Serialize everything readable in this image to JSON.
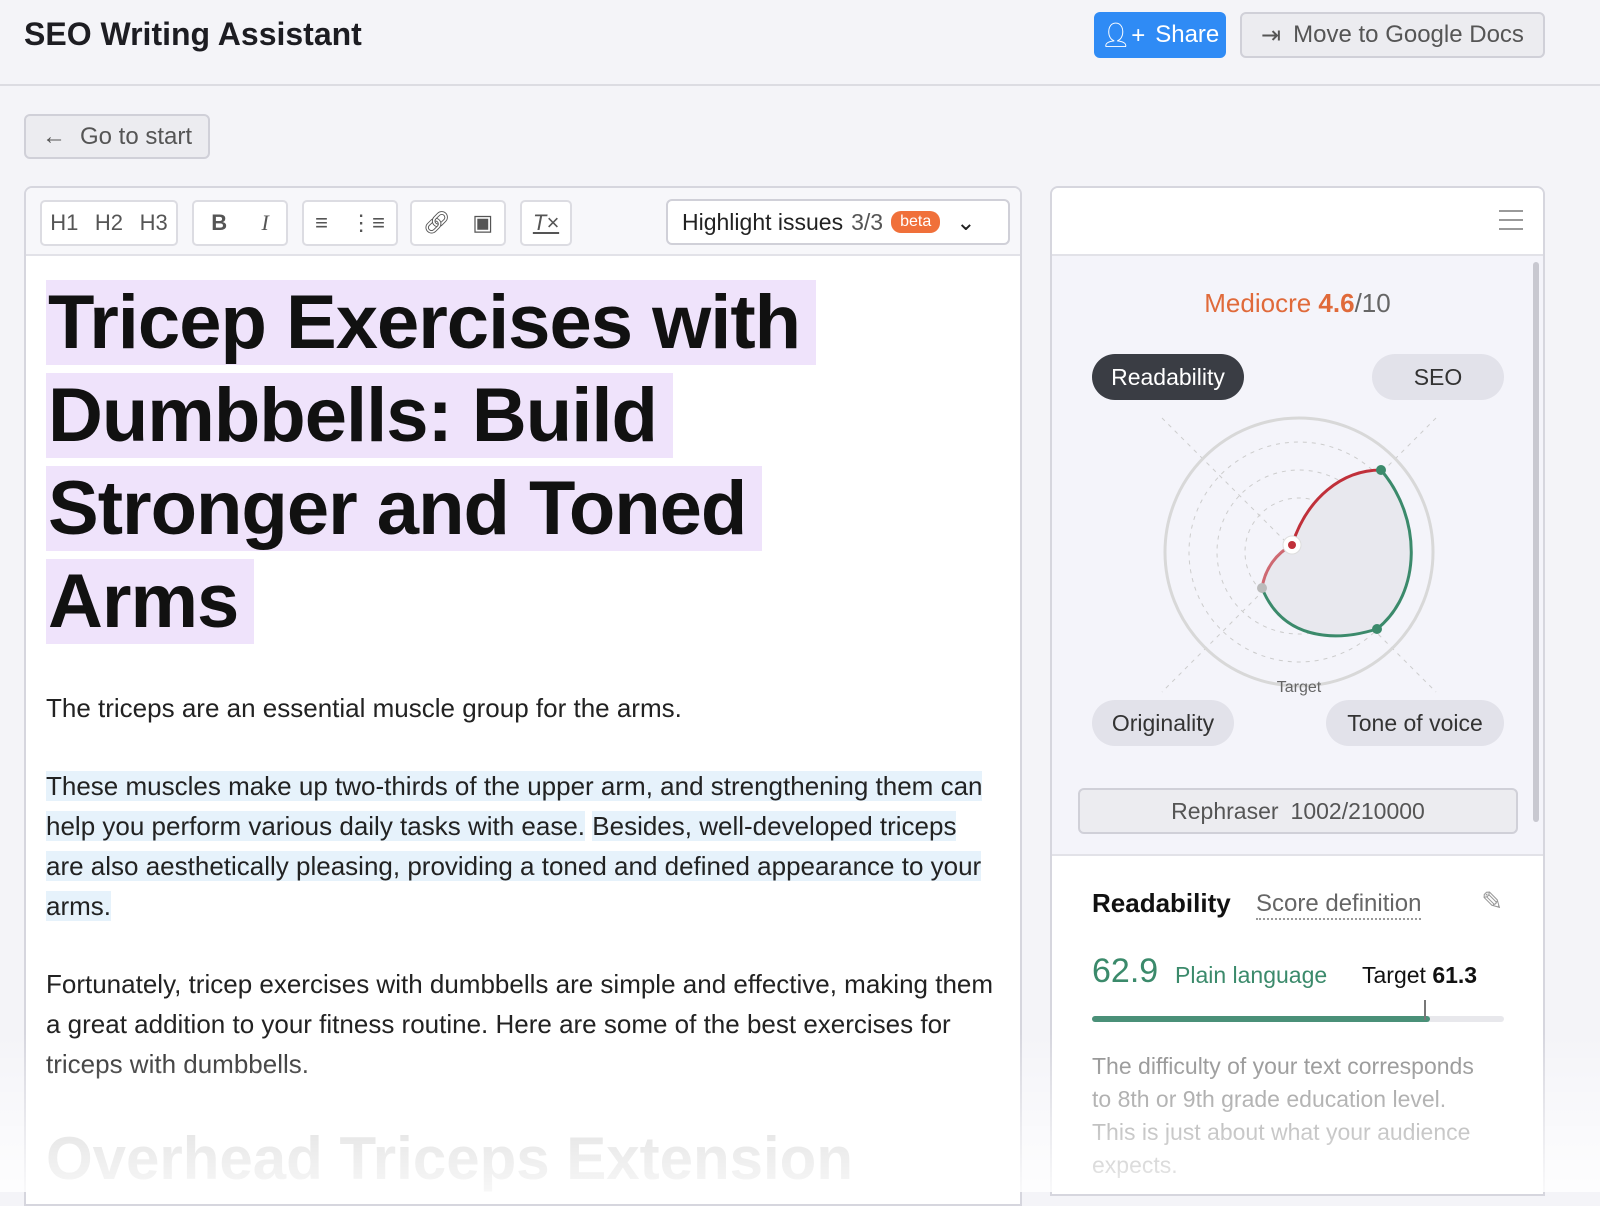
{
  "header": {
    "title": "SEO Writing Assistant",
    "share_label": "Share",
    "gdocs_label": "Move to Google Docs"
  },
  "nav": {
    "go_to_start": "Go to start"
  },
  "toolbar": {
    "h1": "H1",
    "h2": "H2",
    "h3": "H3",
    "bold": "B",
    "italic": "I",
    "highlight_label": "Highlight issues",
    "highlight_count": "3/3",
    "beta": "beta"
  },
  "document": {
    "title": "Tricep Exercises with Dumbbells: Build Stronger and Toned Arms",
    "p1": "The triceps are an essential muscle group for the arms.",
    "p2a": "These muscles make up two-thirds of the upper arm, and strengthening them can help you perform various daily tasks with ease.",
    "p2b": "Besides, well-developed triceps are also aesthetically pleasing, providing a toned and defined appearance to your arms.",
    "p3": "Fortunately, tricep exercises with dumbbells are simple and effective, making them a great addition to your fitness routine. Here are some of the best exercises for triceps with dumbbells.",
    "h2": "Overhead Triceps Extension"
  },
  "panel": {
    "rating": "Mediocre",
    "score": "4.6",
    "score_max": "/10",
    "tabs": {
      "readability": "Readability",
      "seo": "SEO",
      "originality": "Originality",
      "tone": "Tone of voice"
    },
    "radar_target_label": "Target",
    "rephraser_label": "Rephraser",
    "rephraser_count": "1002/210000",
    "readability": {
      "title": "Readability",
      "score_definition": "Score definition",
      "value": "62.9",
      "level": "Plain language",
      "target_label": "Target",
      "target_value": "61.3",
      "fill_fraction": 0.82,
      "target_fraction": 0.805,
      "description": "The difficulty of your text corresponds to 8th or 9th grade education level. This is just about what your audience expects."
    }
  },
  "colors": {
    "accent": "#2f8bf5",
    "score": "#e06a3a",
    "good": "#3b8a6b",
    "bad": "#c0303a",
    "title_highlight": "#efe3fb",
    "para_highlight": "#e6f2fb"
  }
}
